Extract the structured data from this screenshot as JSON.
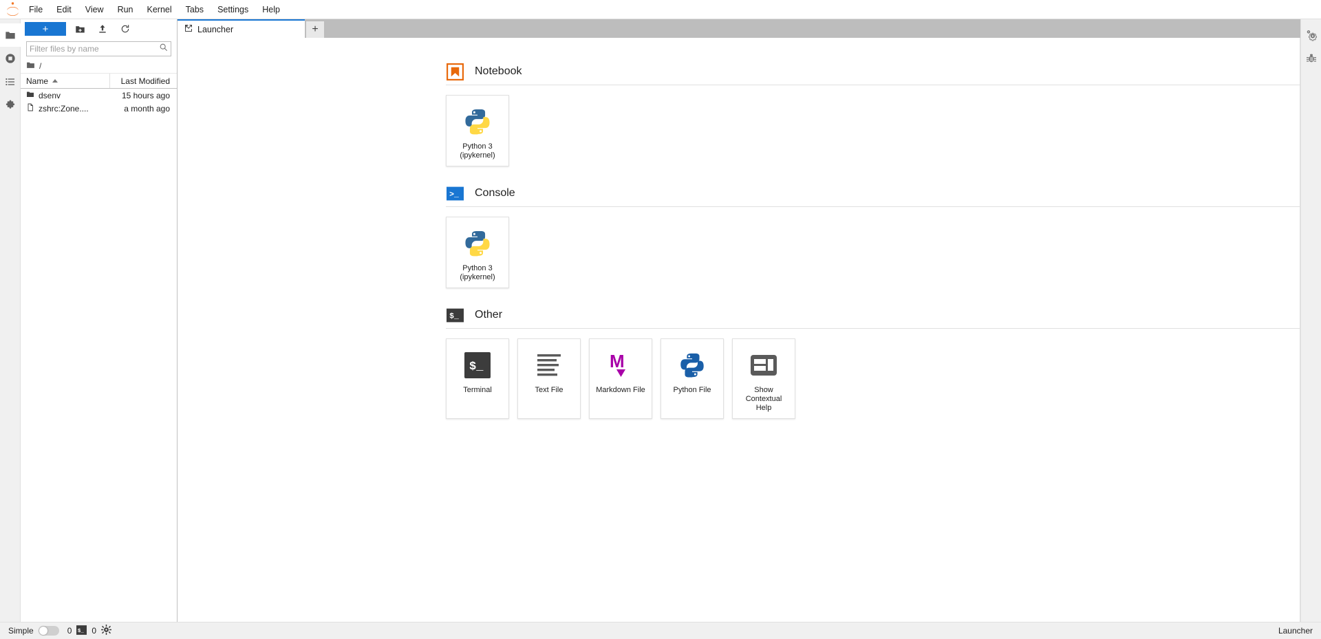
{
  "app": {
    "logo_icon": "jupyter-logo-icon",
    "menu": [
      {
        "label": "File"
      },
      {
        "label": "Edit"
      },
      {
        "label": "View"
      },
      {
        "label": "Run"
      },
      {
        "label": "Kernel"
      },
      {
        "label": "Tabs"
      },
      {
        "label": "Settings"
      },
      {
        "label": "Help"
      }
    ]
  },
  "left_sidebar": {
    "items": [
      {
        "name": "file-browser",
        "icon": "folder-icon",
        "active": true
      },
      {
        "name": "running-sessions",
        "icon": "stop-circle-icon",
        "active": false
      },
      {
        "name": "command-palette",
        "icon": "list-icon",
        "active": false
      },
      {
        "name": "extension-manager",
        "icon": "puzzle-piece-icon",
        "active": false
      }
    ]
  },
  "right_sidebar": {
    "items": [
      {
        "name": "property-inspector",
        "icon": "gears-icon"
      },
      {
        "name": "debugger",
        "icon": "bug-icon"
      }
    ]
  },
  "file_browser": {
    "toolbar": {
      "new_launcher_label": "+",
      "new_folder_icon": "new-folder-icon",
      "upload_icon": "upload-icon",
      "refresh_icon": "refresh-icon"
    },
    "search": {
      "placeholder": "Filter files by name",
      "value": "",
      "icon": "search-icon"
    },
    "breadcrumb": {
      "root_icon": "folder-icon",
      "path": "/"
    },
    "columns": {
      "name": "Name",
      "last_modified": "Last Modified"
    },
    "sort": {
      "column": "Name",
      "direction": "ascending"
    },
    "rows": [
      {
        "icon": "folder-icon",
        "name": "dsenv",
        "modified": "15 hours ago",
        "type": "directory"
      },
      {
        "icon": "file-icon",
        "name": "zshrc:Zone....",
        "modified": "a month ago",
        "type": "file"
      }
    ]
  },
  "tab_bar": {
    "tabs": [
      {
        "label": "Launcher",
        "icon": "launcher-icon",
        "active": true
      }
    ],
    "add_tab_label": "+"
  },
  "launcher": {
    "sections": [
      {
        "title": "Notebook",
        "icon": "notebook-bookmark-icon",
        "icon_color": "#e8690b",
        "cards": [
          {
            "label": "Python 3\n(ipykernel)",
            "label_line1": "Python 3",
            "label_line2": "(ipykernel)",
            "icon": "python-logo-icon"
          }
        ]
      },
      {
        "title": "Console",
        "icon": "console-terminal-icon",
        "icon_color": "#1976d2",
        "cards": [
          {
            "label": "Python 3\n(ipykernel)",
            "label_line1": "Python 3",
            "label_line2": "(ipykernel)",
            "icon": "python-logo-icon"
          }
        ]
      },
      {
        "title": "Other",
        "icon": "other-terminal-icon",
        "icon_color": "#3c3c3c",
        "cards": [
          {
            "label": "Terminal",
            "icon": "terminal-icon"
          },
          {
            "label": "Text File",
            "icon": "text-file-icon"
          },
          {
            "label": "Markdown File",
            "icon": "markdown-icon"
          },
          {
            "label": "Python File",
            "icon": "python-file-icon"
          },
          {
            "label_line1": "Show Contextual",
            "label_line2": "Help",
            "label": "Show Contextual Help",
            "icon": "contextual-help-icon"
          }
        ]
      }
    ]
  },
  "status_bar": {
    "mode_label": "Simple",
    "mode_enabled": false,
    "kernel_count": "0",
    "terminal_icon": "terminal-icon",
    "terminal_count": "0",
    "kernel_icon": "kernel-icon",
    "active_item": "Launcher"
  },
  "colors": {
    "accent": "#1976d2",
    "notebook_orange": "#e8690b",
    "markdown_purple": "#a800a8",
    "python_blue": "#326a9b",
    "python_yellow": "#ffd845",
    "terminal_dark": "#3c3c3c"
  }
}
